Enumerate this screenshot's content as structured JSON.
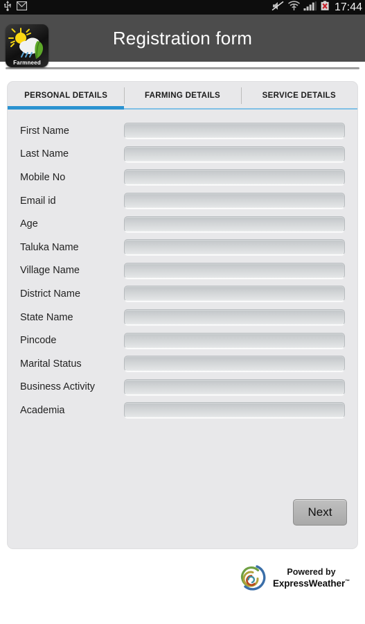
{
  "statusbar": {
    "time": "17:44",
    "left_icons": [
      {
        "name": "usb-icon"
      },
      {
        "name": "gmail-envelope-icon"
      }
    ],
    "right_icons": [
      {
        "name": "volume-muted-icon"
      },
      {
        "name": "wifi-icon"
      },
      {
        "name": "cellular-signal-icon"
      },
      {
        "name": "battery-error-icon"
      }
    ]
  },
  "actionbar": {
    "title": "Registration form",
    "app_icon": {
      "name": "farmneed-app-icon",
      "label": "Farmneed"
    }
  },
  "tabs": [
    {
      "label": "PERSONAL DETAILS",
      "active": true
    },
    {
      "label": "FARMING  DETAILS",
      "active": false
    },
    {
      "label": "SERVICE  DETAILS",
      "active": false
    }
  ],
  "form": {
    "fields": [
      {
        "label": "First Name",
        "value": "",
        "placeholder": ""
      },
      {
        "label": "Last Name",
        "value": "",
        "placeholder": ""
      },
      {
        "label": "Mobile No",
        "value": "",
        "placeholder": ""
      },
      {
        "label": "Email id",
        "value": "",
        "placeholder": ""
      },
      {
        "label": "Age",
        "value": "",
        "placeholder": ""
      },
      {
        "label": "Taluka Name",
        "value": "",
        "placeholder": ""
      },
      {
        "label": "Village Name",
        "value": "",
        "placeholder": ""
      },
      {
        "label": "District Name",
        "value": "",
        "placeholder": ""
      },
      {
        "label": "State Name",
        "value": "",
        "placeholder": ""
      },
      {
        "label": "Pincode",
        "value": "",
        "placeholder": ""
      },
      {
        "label": "Marital Status",
        "value": "",
        "placeholder": ""
      },
      {
        "label": "Business Activity",
        "value": "",
        "placeholder": ""
      },
      {
        "label": "Academia",
        "value": "",
        "placeholder": ""
      }
    ],
    "next_label": "Next"
  },
  "footer": {
    "powered_by": "Powered by",
    "brand": "ExpressWeather",
    "trademark": "™",
    "logo_name": "expressweather-logo"
  },
  "colors": {
    "accent_active_tab": "#2a92d0",
    "accent_inactive_tab": "#7fc0e5",
    "actionbar_bg": "#4c4c4c",
    "panel_bg": "#e8e8ea",
    "statusbar_bg": "#0d0d0d"
  }
}
